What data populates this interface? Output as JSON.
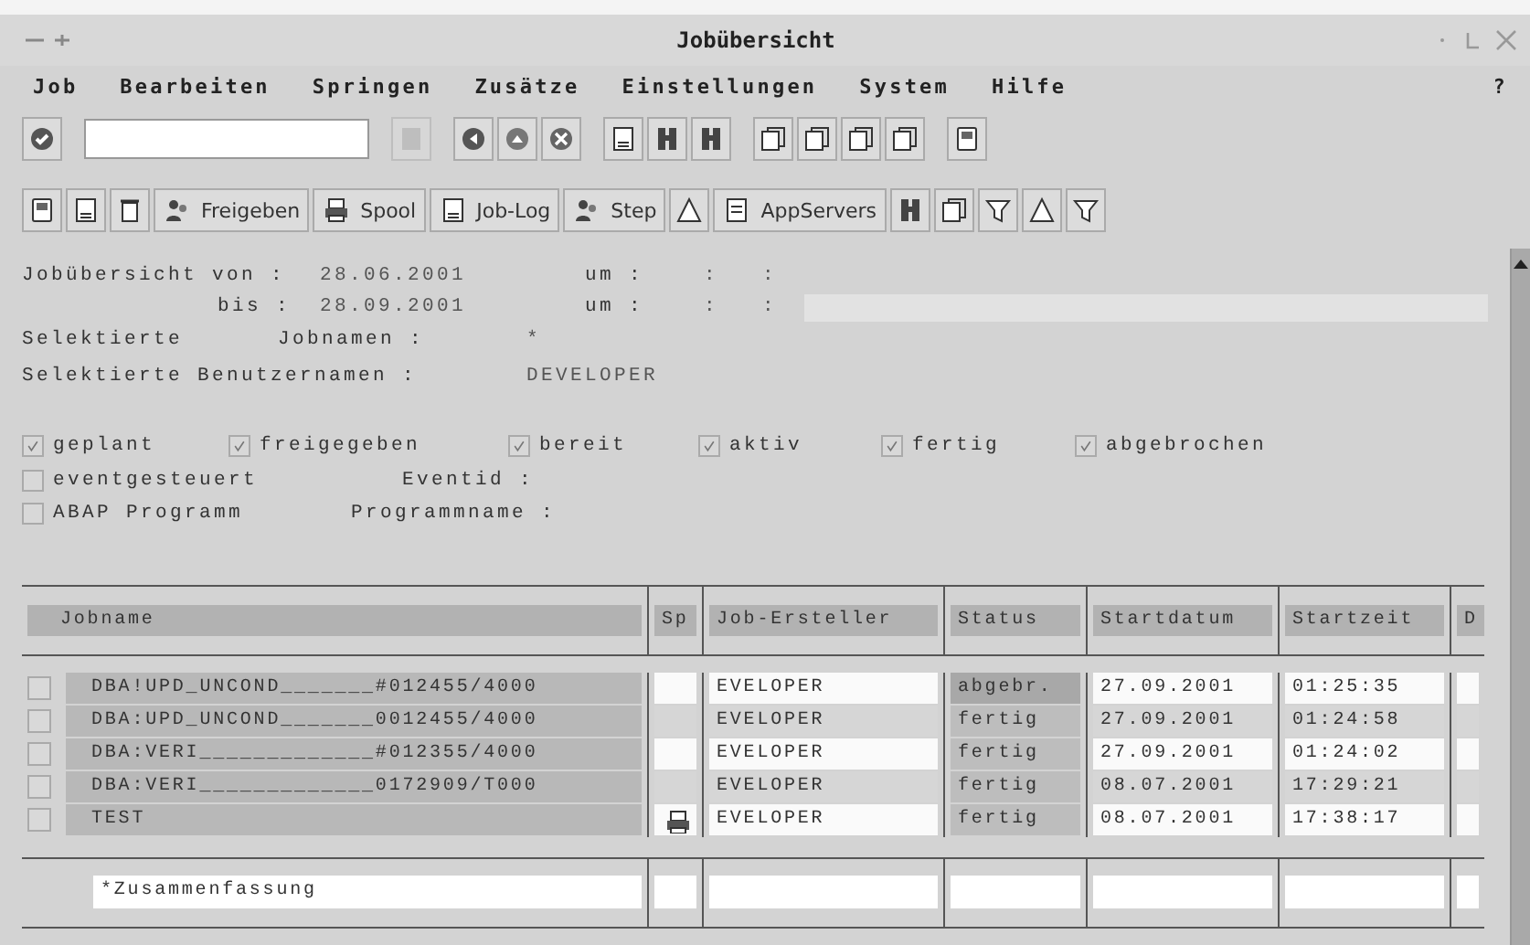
{
  "window": {
    "title": "Jobübersicht"
  },
  "menu": [
    "Job",
    "Bearbeiten",
    "Springen",
    "Zusätze",
    "Einstellungen",
    "System",
    "Hilfe"
  ],
  "help_mark": "?",
  "app_toolbar": [
    {
      "label": "Freigeben"
    },
    {
      "label": "Spool"
    },
    {
      "label": "Job-Log"
    },
    {
      "label": "Step"
    },
    {
      "label": "AppServers"
    }
  ],
  "selection": {
    "from_label": "Jobübersicht von :",
    "from_date": "28.06.2001",
    "from_time_label": "um :",
    "from_time": ":   :",
    "to_label": "bis :",
    "to_date": "28.09.2001",
    "to_time_label": "um :",
    "to_time": ":   :",
    "jobs_label": "Selektierte",
    "jobs_label_2": "Jobnamen :",
    "jobs_value": "*",
    "users_label": "Selektierte Benutzernamen :",
    "users_value": "DEVELOPER"
  },
  "status_filters": [
    {
      "label": "geplant",
      "checked": true
    },
    {
      "label": "freigegeben",
      "checked": true
    },
    {
      "label": "bereit",
      "checked": true
    },
    {
      "label": "aktiv",
      "checked": true
    },
    {
      "label": "fertig",
      "checked": true
    },
    {
      "label": "abgebrochen",
      "checked": true
    }
  ],
  "extra_filters": [
    {
      "label": "eventgesteuert",
      "checked": false,
      "field_label": "Eventid :"
    },
    {
      "label": "ABAP Programm",
      "checked": false,
      "field_label": "Programmname :"
    }
  ],
  "table": {
    "columns": [
      "Jobname",
      "Sp",
      "Job-Ersteller",
      "Status",
      "Startdatum",
      "Startzeit",
      "D"
    ],
    "rows": [
      {
        "jobname": "DBA!UPD_UNCOND_______#012455/4000",
        "spool": false,
        "creator": "EVELOPER",
        "status": "abgebr.",
        "date": "27.09.2001",
        "time": "01:25:35",
        "highlighted": true
      },
      {
        "jobname": "DBA:UPD_UNCOND_______0012455/4000",
        "spool": false,
        "creator": "EVELOPER",
        "status": "fertig",
        "date": "27.09.2001",
        "time": "01:24:58",
        "highlighted": false
      },
      {
        "jobname": "DBA:VERI_____________#012355/4000",
        "spool": false,
        "creator": "EVELOPER",
        "status": "fertig",
        "date": "27.09.2001",
        "time": "01:24:02",
        "highlighted": false
      },
      {
        "jobname": "DBA:VERI_____________0172909/T000",
        "spool": false,
        "creator": "EVELOPER",
        "status": "fertig",
        "date": "08.07.2001",
        "time": "17:29:21",
        "highlighted": false
      },
      {
        "jobname": "TEST",
        "spool": true,
        "creator": "EVELOPER",
        "status": "fertig",
        "date": "08.07.2001",
        "time": "17:38:17",
        "highlighted": false
      }
    ],
    "summary": "*Zusammenfassung"
  }
}
